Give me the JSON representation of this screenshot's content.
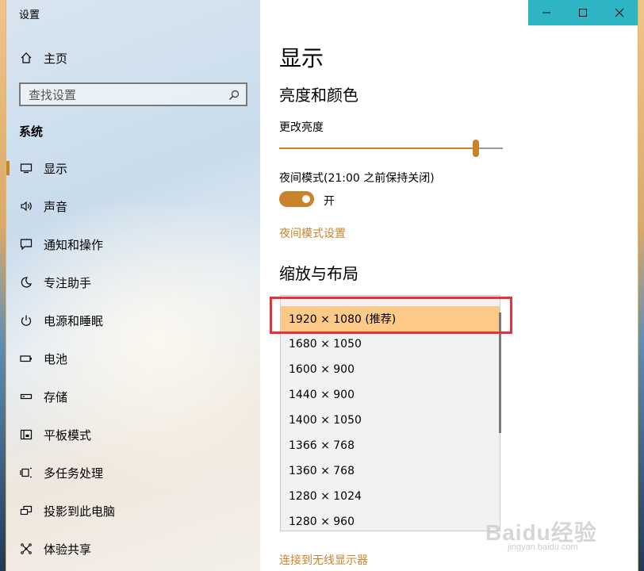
{
  "window": {
    "title": "设置"
  },
  "sidebar": {
    "home": {
      "label": "主页",
      "icon": "home-icon"
    },
    "search": {
      "placeholder": "查找设置",
      "icon": "search-icon"
    },
    "section_title": "系统",
    "items": [
      {
        "label": "显示",
        "icon": "monitor-icon",
        "active": true
      },
      {
        "label": "声音",
        "icon": "speaker-icon"
      },
      {
        "label": "通知和操作",
        "icon": "notification-icon"
      },
      {
        "label": "专注助手",
        "icon": "moon-icon"
      },
      {
        "label": "电源和睡眠",
        "icon": "power-icon"
      },
      {
        "label": "电池",
        "icon": "battery-icon"
      },
      {
        "label": "存储",
        "icon": "storage-icon"
      },
      {
        "label": "平板模式",
        "icon": "tablet-icon"
      },
      {
        "label": "多任务处理",
        "icon": "multitask-icon"
      },
      {
        "label": "投影到此电脑",
        "icon": "project-icon"
      },
      {
        "label": "体验共享",
        "icon": "share-icon"
      }
    ]
  },
  "main": {
    "title": "显示",
    "brightness_section": "亮度和颜色",
    "brightness_label": "更改亮度",
    "brightness_level": 0.89,
    "night_mode_label": "夜间模式(21:00 之前保持关闭)",
    "night_mode_state": "开",
    "night_mode_link": "夜间模式设置",
    "scale_section": "缩放与布局",
    "resolution_options": [
      "1920 × 1080 (推荐)",
      "1680 × 1050",
      "1600 × 900",
      "1440 × 900",
      "1400 × 1050",
      "1366 × 768",
      "1360 × 768",
      "1280 × 1024",
      "1280 × 960"
    ],
    "selected_resolution": "1920 × 1080 (推荐)",
    "wireless_link": "连接到无线显示器"
  },
  "colors": {
    "accent": "#c9832a",
    "selected": "#fcc987",
    "highlight": "#e0353b",
    "caption": "#2eb5c4"
  },
  "watermark": {
    "text": "Baidu经验",
    "sub": "jingyan.baidu.com"
  }
}
